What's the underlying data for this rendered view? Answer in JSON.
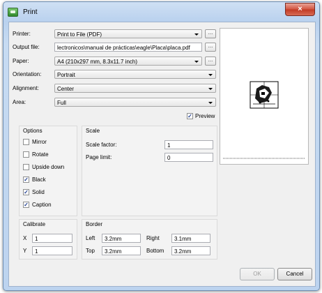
{
  "window": {
    "title": "Print",
    "close_glyph": "×"
  },
  "printer": {
    "label": "Printer:",
    "value": "Print to File (PDF)",
    "browse": "..."
  },
  "output_file": {
    "label": "Output file:",
    "value": "lectronicos\\manual de prácticas\\eagle\\Placa\\placa.pdf",
    "browse": "..."
  },
  "paper": {
    "label": "Paper:",
    "value": "A4 (210x297 mm, 8.3x11.7 inch)",
    "browse": "..."
  },
  "orientation": {
    "label": "Orientation:",
    "value": "Portrait"
  },
  "alignment": {
    "label": "Alignment:",
    "value": "Center"
  },
  "area": {
    "label": "Area:",
    "value": "Full"
  },
  "preview_toggle": {
    "label": "Preview",
    "checked": true
  },
  "options": {
    "title": "Options",
    "items": [
      {
        "label": "Mirror",
        "checked": false
      },
      {
        "label": "Rotate",
        "checked": false
      },
      {
        "label": "Upside down",
        "checked": false
      },
      {
        "label": "Black",
        "checked": true
      },
      {
        "label": "Solid",
        "checked": true
      },
      {
        "label": "Caption",
        "checked": true
      }
    ]
  },
  "scale": {
    "title": "Scale",
    "factor_label": "Scale factor:",
    "factor_value": "1",
    "page_limit_label": "Page limit:",
    "page_limit_value": "0"
  },
  "calibrate": {
    "title": "Calibrate",
    "x_label": "X",
    "x_value": "1",
    "y_label": "Y",
    "y_value": "1"
  },
  "border": {
    "title": "Border",
    "left_label": "Left",
    "left_value": "3.2mm",
    "right_label": "Right",
    "right_value": "3.1mm",
    "top_label": "Top",
    "top_value": "3.2mm",
    "bottom_label": "Bottom",
    "bottom_value": "3.2mm"
  },
  "buttons": {
    "ok": "OK",
    "cancel": "Cancel"
  },
  "check_glyph": "✓"
}
